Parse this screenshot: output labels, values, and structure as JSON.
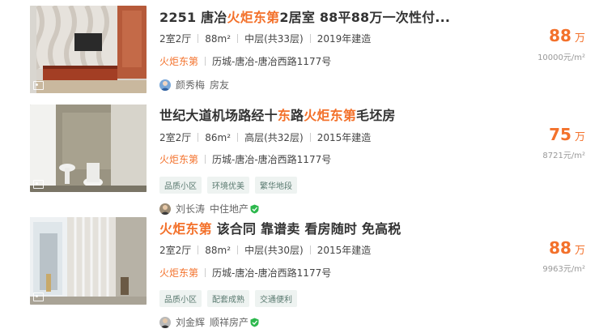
{
  "listings": [
    {
      "title_parts": [
        "2251 唐冶",
        "火炬东第",
        "2居室 88平88万一次性付..."
      ],
      "layout": "2室2厅",
      "area": "88m²",
      "floor": "中层(共33层)",
      "year": "2019年建造",
      "community": "火炬东第",
      "address": "历城-唐冶-唐冶西路1177号",
      "tags": [],
      "agent_name": "颜秀梅",
      "agent_company": "房友",
      "price": "88",
      "price_unit": "万",
      "unit_price": "10000元/m²"
    },
    {
      "title_parts": [
        "世纪大道机场路经十",
        "东",
        "路",
        "火炬东第",
        "毛坯房"
      ],
      "layout": "2室2厅",
      "area": "86m²",
      "floor": "高层(共32层)",
      "year": "2015年建造",
      "community": "火炬东第",
      "address": "历城-唐冶-唐冶西路1177号",
      "tags": [
        "品质小区",
        "环境优美",
        "繁华地段"
      ],
      "agent_name": "刘长涛",
      "agent_company": "中住地产",
      "price": "75",
      "price_unit": "万",
      "unit_price": "8721元/m²"
    },
    {
      "title_parts": [
        "火炬东第",
        " 该合同 靠谱卖 看房随时 免高税"
      ],
      "layout": "2室2厅",
      "area": "88m²",
      "floor": "中层(共30层)",
      "year": "2015年建造",
      "community": "火炬东第",
      "address": "历城-唐冶-唐冶西路1177号",
      "tags": [
        "品质小区",
        "配套成熟",
        "交通便利"
      ],
      "agent_name": "刘金辉",
      "agent_company": "顺祥房产",
      "price": "88",
      "price_unit": "万",
      "unit_price": "9963元/m²"
    }
  ],
  "colors": {
    "accent": "#f3712b",
    "tag_bg": "#eef3f1",
    "tag_text": "#5a7a70"
  }
}
